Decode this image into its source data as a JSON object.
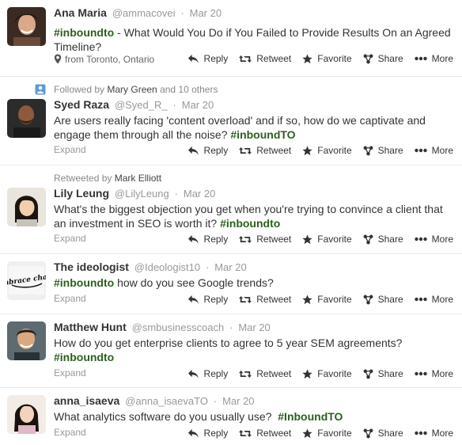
{
  "colors": {
    "hashtag": "#2b5f1f",
    "muted": "#999999",
    "text": "#333333"
  },
  "actions": {
    "reply": "Reply",
    "retweet": "Retweet",
    "favorite": "Favorite",
    "share": "Share",
    "more": "More"
  },
  "expand_label": "Expand",
  "tweets": [
    {
      "fullname": "Ana Maria",
      "username": "@ammacovei",
      "time": "Mar 20",
      "hashtag1": "#inboundto",
      "text1": " - What Would You Do if You Failed to Provide Results On an Agreed Timeline?",
      "location": "from Toronto, Ontario"
    },
    {
      "context_prefix": "Followed by",
      "context_who": "Mary Green",
      "context_suffix": "and 10 others",
      "fullname": "Syed Raza",
      "username": "@Syed_R_",
      "time": "Mar 20",
      "text1": "Are users really facing 'content overload' and if so, how do we captivate and engage them through all the noise? ",
      "hashtag1": "#inboundTO"
    },
    {
      "context_prefix": "Retweeted by",
      "context_who": "Mark Elliott",
      "fullname": "Lily Leung",
      "username": "@LilyLeung",
      "time": "Mar 20",
      "text1": "What's the biggest objection you get when you're trying to convince a client that an investment in SEO is worth it? ",
      "hashtag1": "#inboundto"
    },
    {
      "fullname": "The ideologist",
      "username": "@Ideologist10",
      "time": "Mar 20",
      "hashtag1": "#inboundto",
      "text1": " how do you see Google trends?",
      "avatar_text": "embrace chaos"
    },
    {
      "fullname": "Matthew Hunt",
      "username": "@smbusinesscoach",
      "time": "Mar 20",
      "text1": "How do you get enterprise clients to agree to 5 year SEM agreements?",
      "hashtag1": "#inboundto"
    },
    {
      "fullname": "anna_isaeva",
      "username": "@anna_isaevaTO",
      "time": "Mar 20",
      "text1": "What analytics software do you usually use?  ",
      "hashtag1": "#InboundTO"
    }
  ]
}
